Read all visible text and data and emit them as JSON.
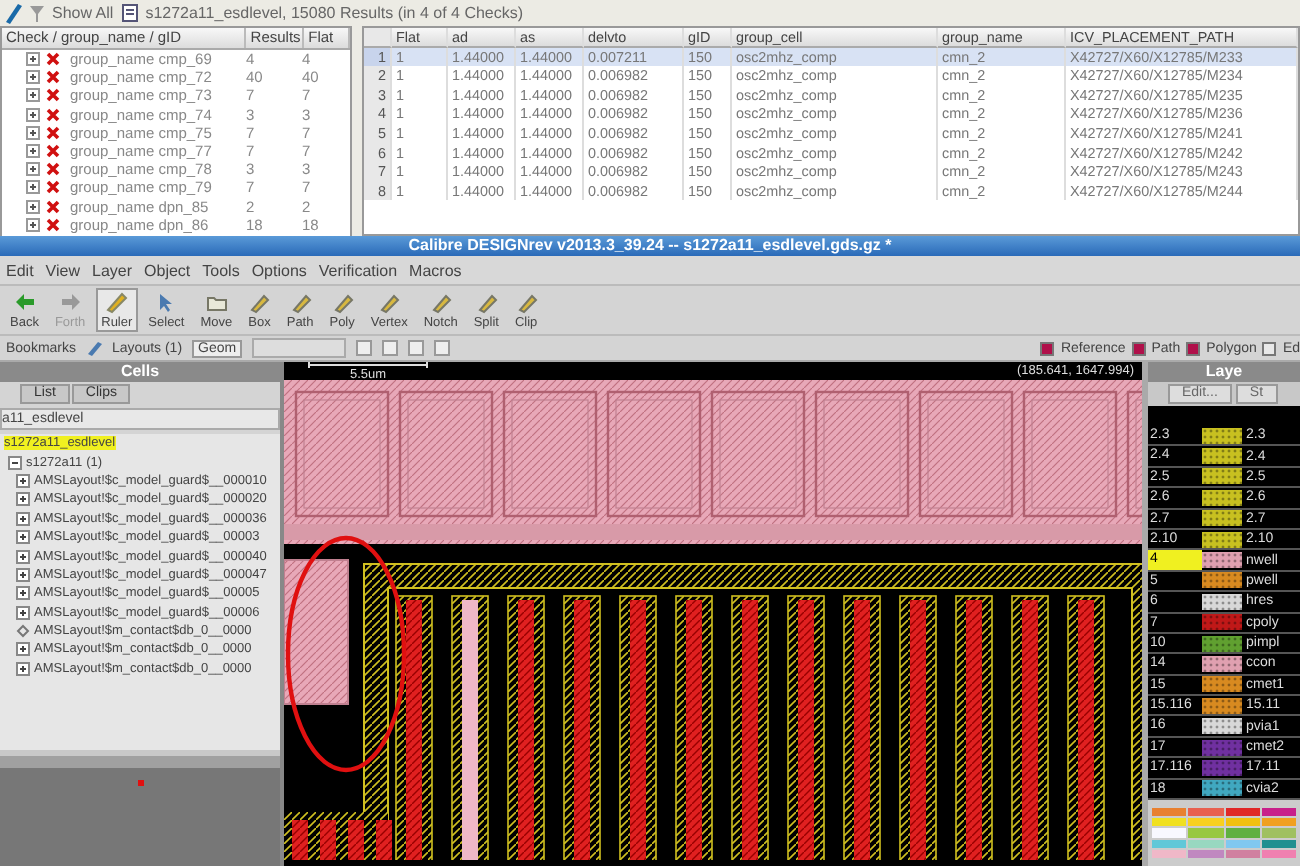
{
  "results_toolbar": {
    "show_all": "Show All",
    "summary": "s1272a11_esdlevel, 15080 Results (in 4 of 4 Checks)"
  },
  "check_tree": {
    "columns": [
      "Check / group_name / gID",
      "Results",
      "Flat"
    ],
    "rows": [
      {
        "name": "group_name cmp_69",
        "results": "4",
        "flat": "4",
        "expanded": false
      },
      {
        "name": "group_name cmp_72",
        "results": "40",
        "flat": "40",
        "expanded": false
      },
      {
        "name": "group_name cmp_73",
        "results": "7",
        "flat": "7",
        "expanded": false
      },
      {
        "name": "group_name cmp_74",
        "results": "3",
        "flat": "3",
        "expanded": false
      },
      {
        "name": "group_name cmp_75",
        "results": "7",
        "flat": "7",
        "expanded": false
      },
      {
        "name": "group_name cmp_77",
        "results": "7",
        "flat": "7",
        "expanded": false
      },
      {
        "name": "group_name cmp_78",
        "results": "3",
        "flat": "3",
        "expanded": false
      },
      {
        "name": "group_name cmp_79",
        "results": "7",
        "flat": "7",
        "expanded": false
      },
      {
        "name": "group_name dpn_85",
        "results": "2",
        "flat": "2",
        "expanded": false
      },
      {
        "name": "group_name dpn_86",
        "results": "18",
        "flat": "18",
        "expanded": false
      }
    ]
  },
  "results_table": {
    "columns": [
      "Flat",
      "ad",
      "as",
      "delvto",
      "gID",
      "group_cell",
      "group_name",
      "ICV_PLACEMENT_PATH"
    ],
    "rows": [
      {
        "index": "1",
        "selected": true,
        "cells": [
          "1",
          "1.44000",
          "1.44000",
          "0.007211",
          "150",
          "osc2mhz_comp",
          "cmn_2",
          "X42727/X60/X12785/M233"
        ]
      },
      {
        "index": "2",
        "selected": false,
        "cells": [
          "1",
          "1.44000",
          "1.44000",
          "0.006982",
          "150",
          "osc2mhz_comp",
          "cmn_2",
          "X42727/X60/X12785/M234"
        ]
      },
      {
        "index": "3",
        "selected": false,
        "cells": [
          "1",
          "1.44000",
          "1.44000",
          "0.006982",
          "150",
          "osc2mhz_comp",
          "cmn_2",
          "X42727/X60/X12785/M235"
        ]
      },
      {
        "index": "4",
        "selected": false,
        "cells": [
          "1",
          "1.44000",
          "1.44000",
          "0.006982",
          "150",
          "osc2mhz_comp",
          "cmn_2",
          "X42727/X60/X12785/M236"
        ]
      },
      {
        "index": "5",
        "selected": false,
        "cells": [
          "1",
          "1.44000",
          "1.44000",
          "0.006982",
          "150",
          "osc2mhz_comp",
          "cmn_2",
          "X42727/X60/X12785/M241"
        ]
      },
      {
        "index": "6",
        "selected": false,
        "cells": [
          "1",
          "1.44000",
          "1.44000",
          "0.006982",
          "150",
          "osc2mhz_comp",
          "cmn_2",
          "X42727/X60/X12785/M242"
        ]
      },
      {
        "index": "7",
        "selected": false,
        "cells": [
          "1",
          "1.44000",
          "1.44000",
          "0.006982",
          "150",
          "osc2mhz_comp",
          "cmn_2",
          "X42727/X60/X12785/M243"
        ]
      },
      {
        "index": "8",
        "selected": false,
        "cells": [
          "1",
          "1.44000",
          "1.44000",
          "0.006982",
          "150",
          "osc2mhz_comp",
          "cmn_2",
          "X42727/X60/X12785/M244"
        ]
      }
    ]
  },
  "window": {
    "title": "Calibre DESIGNrev v2013.3_39.24 -- s1272a11_esdlevel.gds.gz *"
  },
  "menu": [
    "Edit",
    "View",
    "Layer",
    "Object",
    "Tools",
    "Options",
    "Verification",
    "Macros"
  ],
  "toolbar": [
    {
      "label": "Back",
      "disabled": false,
      "selected": false
    },
    {
      "label": "Forth",
      "disabled": true,
      "selected": false
    },
    {
      "label": "Ruler",
      "disabled": false,
      "selected": true
    },
    {
      "label": "Select",
      "disabled": false,
      "selected": false
    },
    {
      "label": "Move",
      "disabled": false,
      "selected": false
    },
    {
      "label": "Box",
      "disabled": false,
      "selected": false
    },
    {
      "label": "Path",
      "disabled": false,
      "selected": false
    },
    {
      "label": "Poly",
      "disabled": false,
      "selected": false
    },
    {
      "label": "Vertex",
      "disabled": false,
      "selected": false
    },
    {
      "label": "Notch",
      "disabled": false,
      "selected": false
    },
    {
      "label": "Split",
      "disabled": false,
      "selected": false
    },
    {
      "label": "Clip",
      "disabled": false,
      "selected": false
    }
  ],
  "bookmark_bar": {
    "bookmarks": "Bookmarks",
    "layouts": "Layouts (1)",
    "geom": "Geom",
    "legend": [
      {
        "label": "Reference",
        "checked": true
      },
      {
        "label": "Path",
        "checked": true
      },
      {
        "label": "Polygon",
        "checked": true
      },
      {
        "label": "Ed",
        "checked": false
      }
    ]
  },
  "cells": {
    "title": "Cells",
    "tabs": [
      {
        "label": "List",
        "selected": false
      },
      {
        "label": "Clips",
        "selected": false
      }
    ],
    "filter": "a11_esdlevel",
    "top_cell": {
      "label": "s1272a11_esdlevel",
      "selected": true
    },
    "tree": {
      "label": "s1272a11",
      "count": "(1)",
      "expanded": true,
      "children": [
        {
          "label": "AMSLayout!$c_model_guard$__000010",
          "expanded": false
        },
        {
          "label": "AMSLayout!$c_model_guard$__000020",
          "expanded": false
        },
        {
          "label": "AMSLayout!$c_model_guard$__000036",
          "expanded": false
        },
        {
          "label": "AMSLayout!$c_model_guard$__00003",
          "expanded": false
        },
        {
          "label": "AMSLayout!$c_model_guard$__000040",
          "expanded": false
        },
        {
          "label": "AMSLayout!$c_model_guard$__000047",
          "expanded": false
        },
        {
          "label": "AMSLayout!$c_model_guard$__00005",
          "expanded": false
        },
        {
          "label": "AMSLayout!$c_model_guard$__00006",
          "expanded": false
        },
        {
          "label": "AMSLayout!$m_contact$db_0__0000"
        },
        {
          "label": "AMSLayout!$m_contact$db_0__0000",
          "expanded": false
        },
        {
          "label": "AMSLayout!$m_contact$db_0__0000",
          "expanded": false
        }
      ]
    }
  },
  "canvas": {
    "scale": "5.5um",
    "coordinates": "(185.641, 1647.994)"
  },
  "layers": {
    "title": "Laye",
    "buttons": [
      "Edit...",
      "St"
    ],
    "rows": [
      {
        "name": "2.3",
        "label": "2.3",
        "color": "#c8c020",
        "selected": false
      },
      {
        "name": "2.4",
        "label": "2.4",
        "color": "#c8c020",
        "selected": false
      },
      {
        "name": "2.5",
        "label": "2.5",
        "color": "#c8c020",
        "selected": false
      },
      {
        "name": "2.6",
        "label": "2.6",
        "color": "#c8c020",
        "selected": false
      },
      {
        "name": "2.7",
        "label": "2.7",
        "color": "#c8c020",
        "selected": false
      },
      {
        "name": "2.10",
        "label": "2.10",
        "color": "#c8c020",
        "selected": false
      },
      {
        "name": "4",
        "label": "nwell",
        "color": "#e0a0b0",
        "selected": true
      },
      {
        "name": "5",
        "label": "pwell",
        "color": "#d88a20",
        "selected": false
      },
      {
        "name": "6",
        "label": "hres",
        "color": "#d8d8d8",
        "selected": false
      },
      {
        "name": "7",
        "label": "cpoly",
        "color": "#c01818",
        "selected": false
      },
      {
        "name": "10",
        "label": "pimpl",
        "color": "#60a030",
        "selected": false
      },
      {
        "name": "14",
        "label": "ccon",
        "color": "#e0a0b0",
        "selected": false
      },
      {
        "name": "15",
        "label": "cmet1",
        "color": "#d88a20",
        "selected": false
      },
      {
        "name": "15.116",
        "label": "15.11",
        "color": "#d88a20",
        "selected": false
      },
      {
        "name": "16",
        "label": "pvia1",
        "color": "#d8d8d8",
        "selected": false
      },
      {
        "name": "17",
        "label": "cmet2",
        "color": "#7030a0",
        "selected": false
      },
      {
        "name": "17.116",
        "label": "17.11",
        "color": "#7030a0",
        "selected": false
      },
      {
        "name": "18",
        "label": "cvia2",
        "color": "#40a8c0",
        "selected": false
      }
    ]
  }
}
